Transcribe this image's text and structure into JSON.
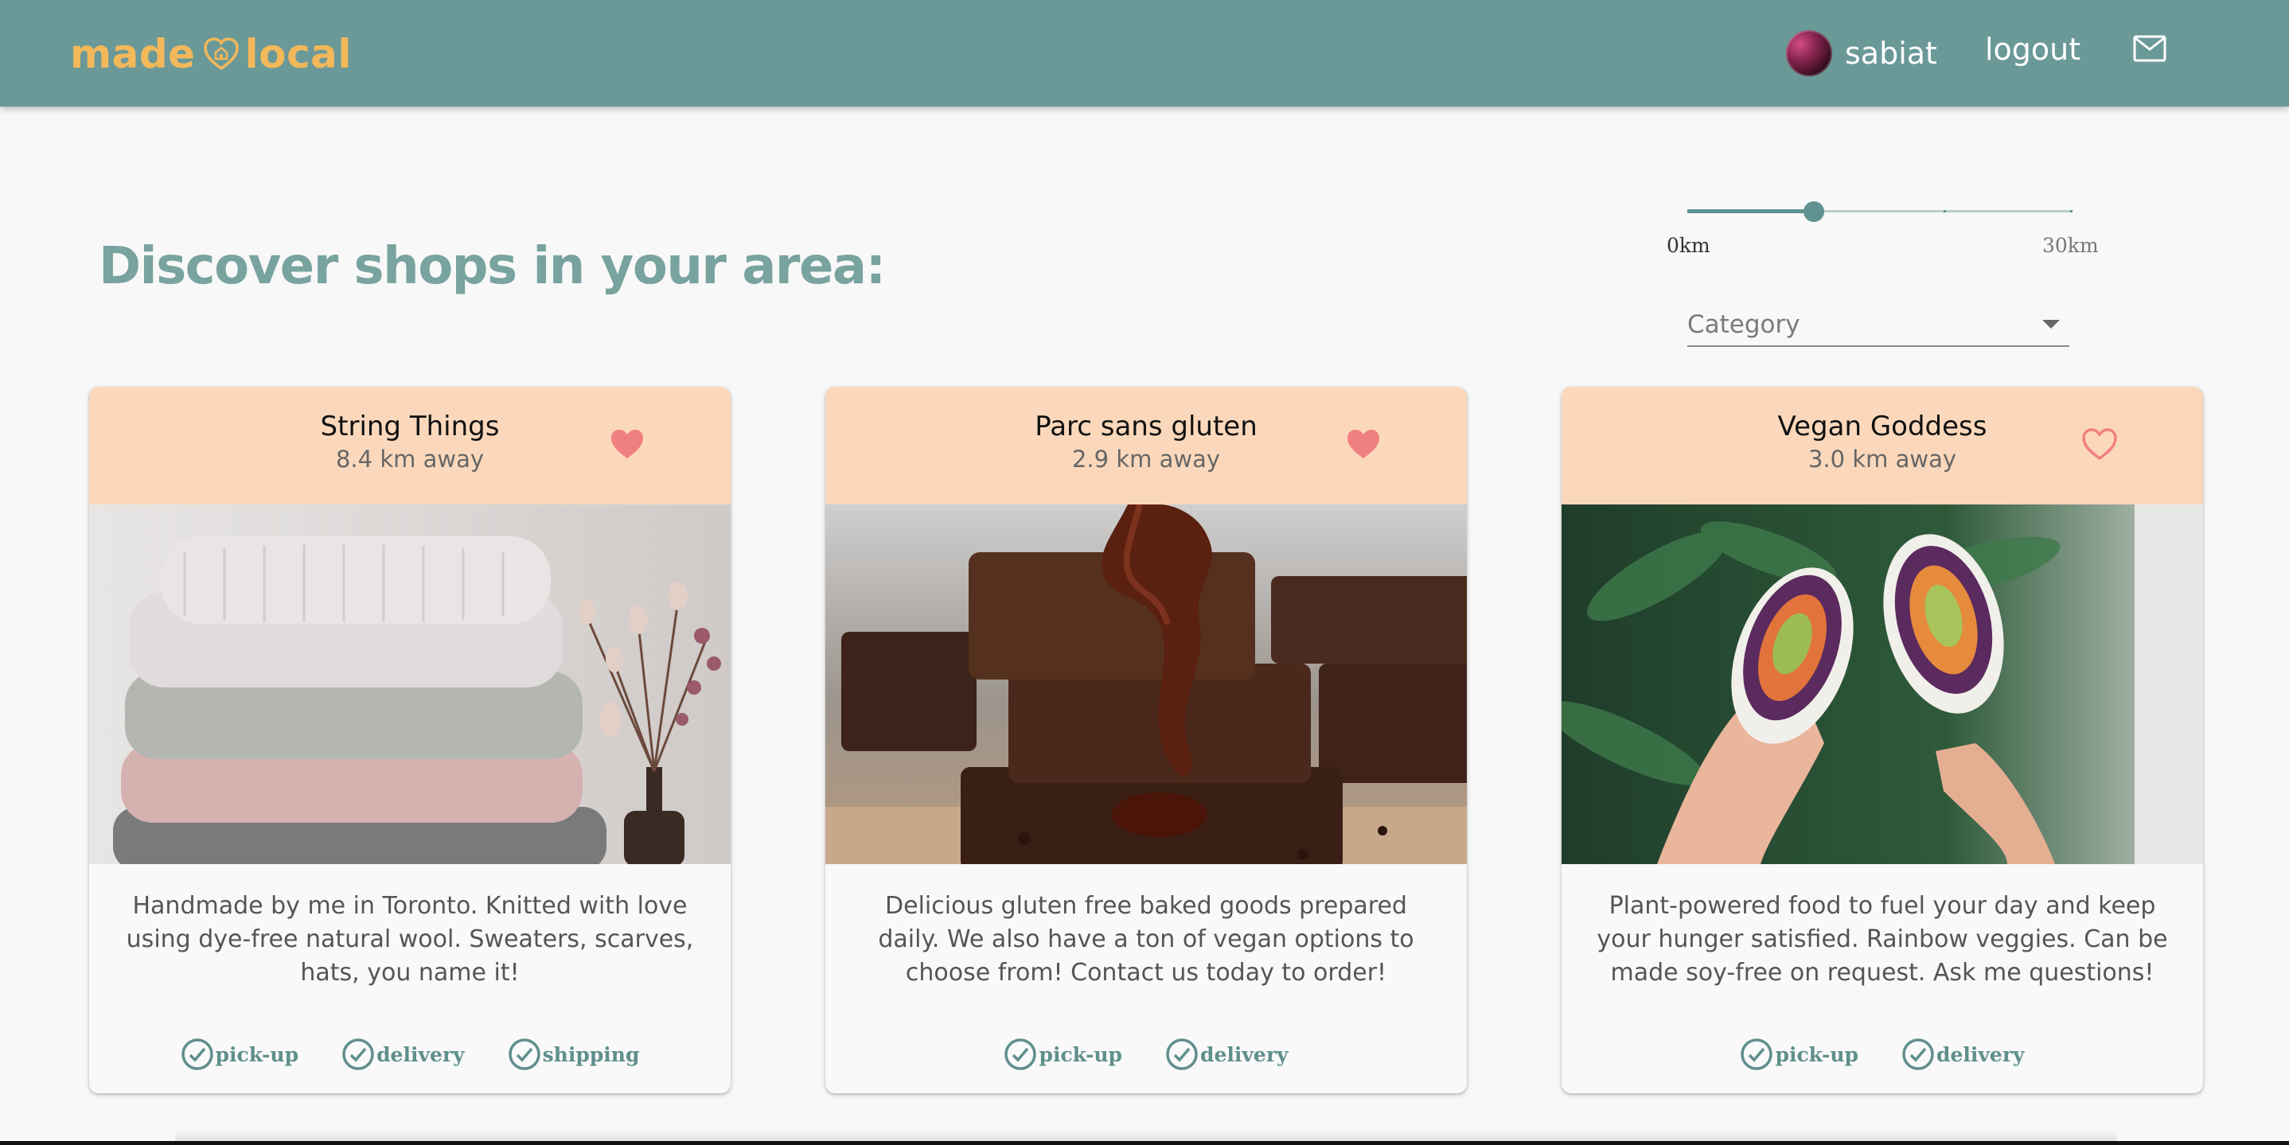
{
  "nav": {
    "logo_left": "made",
    "logo_right": "local",
    "username": "sabiat",
    "logout_label": "logout",
    "mail_icon": "mail-icon"
  },
  "headline": "Discover shops in your area:",
  "distance_filter": {
    "min_label": "0km",
    "max_label": "30km",
    "value_fraction": 0.33
  },
  "category_select": {
    "label": "Category"
  },
  "colors": {
    "nav": "#6a9998",
    "logo": "#f3b85a",
    "card_header": "#fbd8bb",
    "heart": "#f08080",
    "accent": "#5f8f8c"
  },
  "shops": [
    {
      "name": "String Things",
      "distance": "8.4 km away",
      "favorited": true,
      "image": "stacked knit sweaters with dried flowers",
      "description": "Handmade by me in Toronto. Knitted with love using dye-free natural wool. Sweaters, scarves, hats, you name it!",
      "tags": [
        "pick-up",
        "delivery",
        "shipping"
      ]
    },
    {
      "name": "Parc sans gluten",
      "distance": "2.9 km away",
      "favorited": true,
      "image": "stacked chocolate brownies with sauce",
      "description": "Delicious gluten free baked goods prepared daily. We also have a ton of vegan options to choose from! Contact us today to order!",
      "tags": [
        "pick-up",
        "delivery"
      ]
    },
    {
      "name": "Vegan Goddess",
      "distance": "3.0 km away",
      "favorited": false,
      "image": "hands holding sushi burritos",
      "description": "Plant-powered food to fuel your day and keep your hunger satisfied. Rainbow veggies. Can be made soy-free on request. Ask me questions!",
      "tags": [
        "pick-up",
        "delivery"
      ]
    }
  ]
}
